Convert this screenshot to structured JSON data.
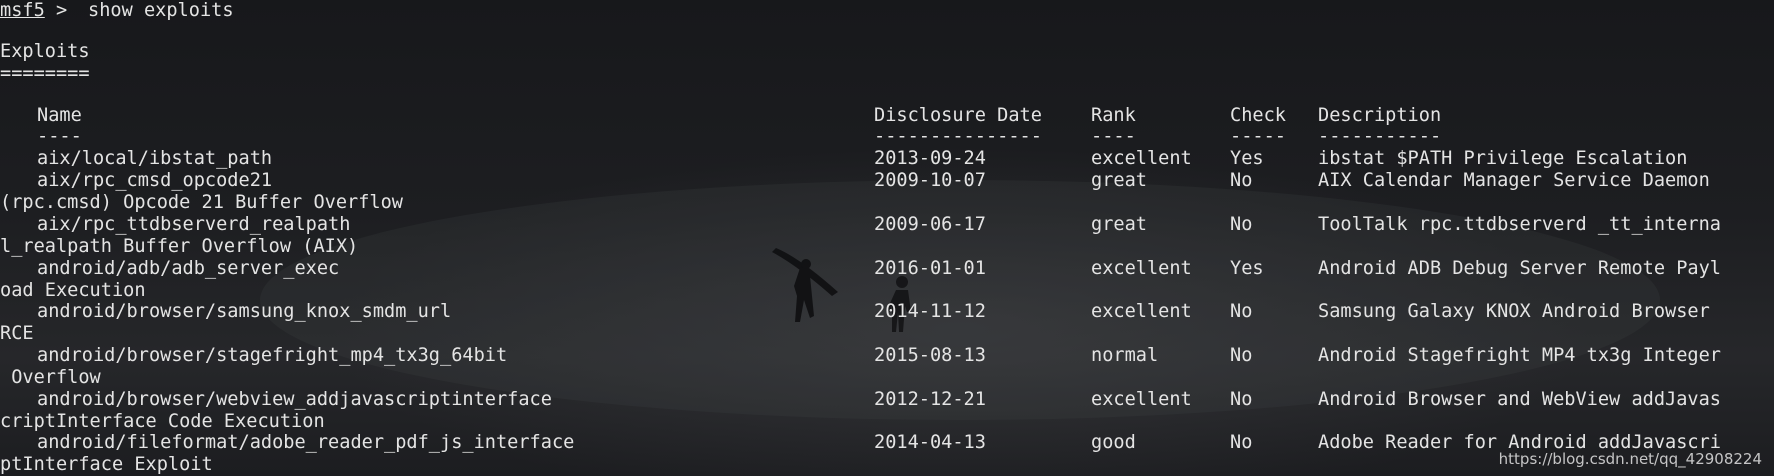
{
  "prompt": {
    "name": "msf5",
    "symbol": ">",
    "command": "show exploits"
  },
  "section": {
    "title": "Exploits",
    "underline": "========"
  },
  "table": {
    "headers": {
      "name": "Name",
      "date": "Disclosure Date",
      "rank": "Rank",
      "check": "Check",
      "description": "Description"
    },
    "separators": {
      "name": "----",
      "date": "---------------",
      "rank": "----",
      "check": "-----",
      "description": "-----------"
    },
    "rows": [
      {
        "name": "aix/local/ibstat_path",
        "date": "2013-09-24",
        "rank": "excellent",
        "check": "Yes",
        "description": "ibstat $PATH Privilege Escalation",
        "wrap": ""
      },
      {
        "name": "aix/rpc_cmsd_opcode21",
        "date": "2009-10-07",
        "rank": "great",
        "check": "No",
        "description": "AIX Calendar Manager Service Daemon",
        "wrap": "(rpc.cmsd) Opcode 21 Buffer Overflow"
      },
      {
        "name": "aix/rpc_ttdbserverd_realpath",
        "date": "2009-06-17",
        "rank": "great",
        "check": "No",
        "description": "ToolTalk rpc.ttdbserverd _tt_interna",
        "wrap": "l_realpath Buffer Overflow (AIX)"
      },
      {
        "name": "android/adb/adb_server_exec",
        "date": "2016-01-01",
        "rank": "excellent",
        "check": "Yes",
        "description": "Android ADB Debug Server Remote Payl",
        "wrap": "oad Execution"
      },
      {
        "name": "android/browser/samsung_knox_smdm_url",
        "date": "2014-11-12",
        "rank": "excellent",
        "check": "No",
        "description": "Samsung Galaxy KNOX Android Browser",
        "wrap": "RCE"
      },
      {
        "name": "android/browser/stagefright_mp4_tx3g_64bit",
        "date": "2015-08-13",
        "rank": "normal",
        "check": "No",
        "description": "Android Stagefright MP4 tx3g Integer",
        "wrap": " Overflow"
      },
      {
        "name": "android/browser/webview_addjavascriptinterface",
        "date": "2012-12-21",
        "rank": "excellent",
        "check": "No",
        "description": "Android Browser and WebView addJavas",
        "wrap": "criptInterface Code Execution"
      },
      {
        "name": "android/fileformat/adobe_reader_pdf_js_interface",
        "date": "2014-04-13",
        "rank": "good",
        "check": "No",
        "description": "Adobe Reader for Android addJavascri",
        "wrap": "ptInterface Exploit"
      }
    ]
  },
  "watermark": "https://blog.csdn.net/qq_42908224",
  "colors": {
    "text": "#e4e4e4",
    "background": "#1b1c1f"
  }
}
